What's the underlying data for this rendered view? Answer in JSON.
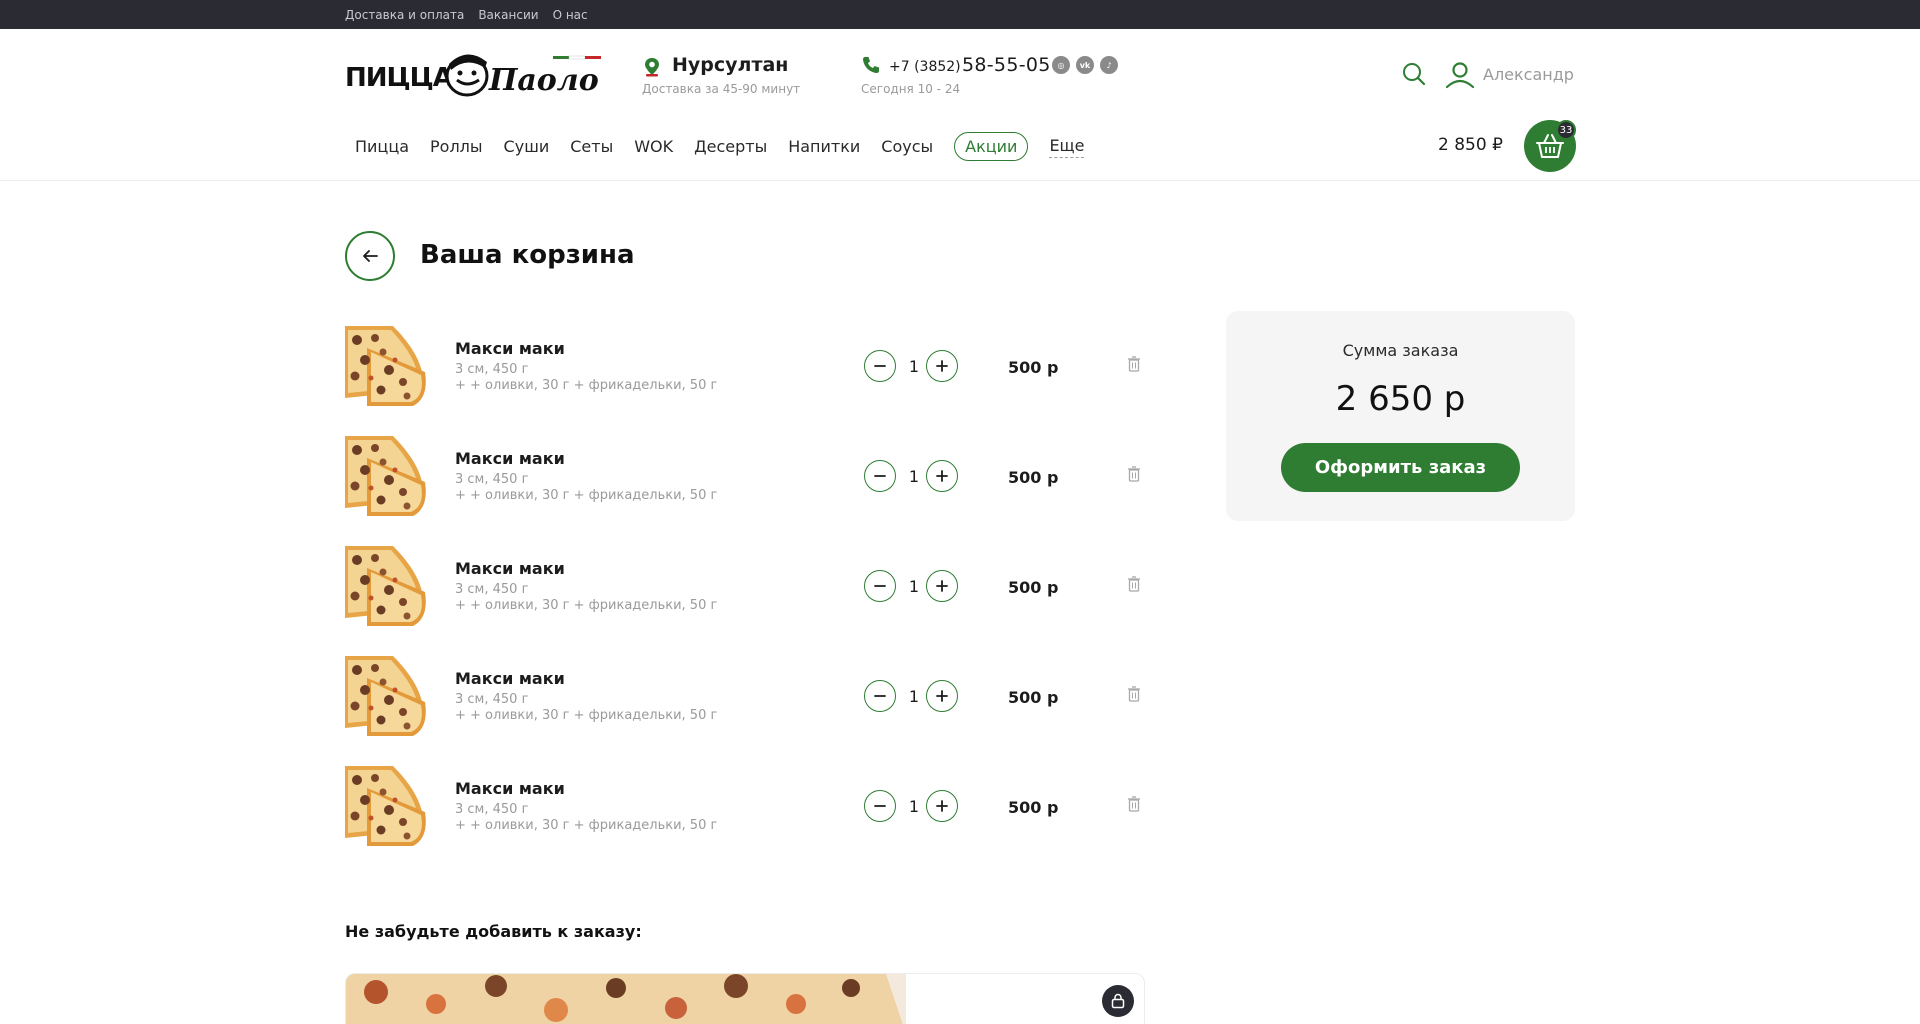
{
  "topbar": {
    "links": [
      "Доставка и оплата",
      "Вакансии",
      "О нас"
    ]
  },
  "header": {
    "logo_text": "ПИЦЦА Паоло",
    "city": "Нурсултан",
    "delivery_time": "Доставка за 45-90 минут",
    "phone_prefix": "+7 (3852)",
    "phone_number": "58-55-05",
    "hours": "Сегодня 10 - 24",
    "socials": [
      "instagram-icon",
      "vk-icon",
      "tiktok-icon"
    ],
    "user_name": "Александр"
  },
  "nav": {
    "items": [
      "Пицца",
      "Роллы",
      "Суши",
      "Сеты",
      "WOK",
      "Десерты",
      "Напитки",
      "Соусы",
      "Акции",
      "Еще"
    ]
  },
  "cart": {
    "total": "2 850 ₽",
    "count": "33"
  },
  "page": {
    "title": "Ваша корзина"
  },
  "items": [
    {
      "name": "Макси маки",
      "size": "3 см, 450 г",
      "extras": "+ + оливки, 30 г + фрикадельки, 50 г",
      "qty": "1",
      "price": "500 р"
    },
    {
      "name": "Макси маки",
      "size": "3 см, 450 г",
      "extras": "+ + оливки, 30 г + фрикадельки, 50 г",
      "qty": "1",
      "price": "500 р"
    },
    {
      "name": "Макси маки",
      "size": "3 см, 450 г",
      "extras": "+ + оливки, 30 г + фрикадельки, 50 г",
      "qty": "1",
      "price": "500 р"
    },
    {
      "name": "Макси маки",
      "size": "3 см, 450 г",
      "extras": "+ + оливки, 30 г + фрикадельки, 50 г",
      "qty": "1",
      "price": "500 р"
    },
    {
      "name": "Макси маки",
      "size": "3 см, 450 г",
      "extras": "+ + оливки, 30 г + фрикадельки, 50 г",
      "qty": "1",
      "price": "500 р"
    }
  ],
  "summary": {
    "label": "Сумма заказа",
    "total": "2 650 р",
    "checkout_label": "Оформить заказ"
  },
  "upsell": {
    "title": "Не забудьте добавить к заказу:"
  },
  "colors": {
    "accent": "#2e7d32",
    "topbar": "#2b2b33",
    "muted": "#9a9a9a"
  }
}
